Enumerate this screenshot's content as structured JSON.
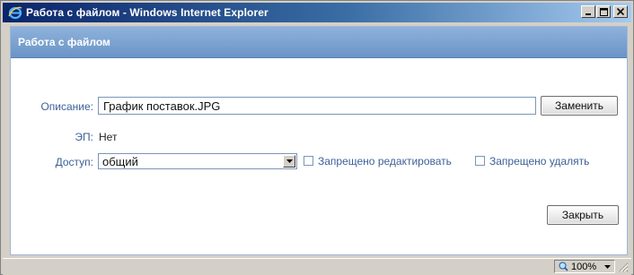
{
  "window": {
    "title": "Работа с файлом - Windows Internet Explorer"
  },
  "panel": {
    "title": "Работа с файлом"
  },
  "form": {
    "description_label": "Описание:",
    "description_value": "График поставок.JPG",
    "replace_button": "Заменить",
    "ep_label": "ЭП:",
    "ep_value": "Нет",
    "access_label": "Доступ:",
    "access_value": "общий",
    "no_edit_label": "Запрещено редактировать",
    "no_delete_label": "Запрещено удалять",
    "close_button": "Закрыть"
  },
  "statusbar": {
    "zoom": "100%"
  },
  "colors": {
    "title_gradient_start": "#0a246a",
    "panel_header": "#7ea3d2",
    "label_blue": "#3b5f99"
  }
}
